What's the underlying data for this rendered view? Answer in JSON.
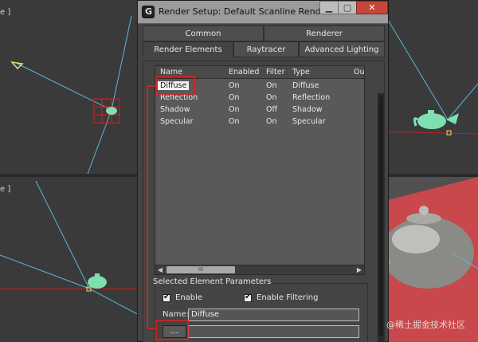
{
  "viewports": {
    "top_left_label": "e ]",
    "bottom_left_label": "e ]"
  },
  "dialog": {
    "title": "Render Setup: Default Scanline Renderer",
    "window_buttons": {
      "minimize": "▁",
      "restore": "▢",
      "close": "✕"
    },
    "tabs_row1": [
      "Common",
      "Renderer"
    ],
    "tabs_row2": [
      "Render Elements",
      "Raytracer",
      "Advanced Lighting"
    ],
    "active_tab": "Render Elements",
    "list": {
      "columns": [
        "Name",
        "Enabled",
        "Filter",
        "Type",
        "Ou"
      ],
      "rows": [
        {
          "name": "Diffuse",
          "enabled": "On",
          "filter": "On",
          "type": "Diffuse"
        },
        {
          "name": "Reflection",
          "enabled": "On",
          "filter": "On",
          "type": "Reflection"
        },
        {
          "name": "Shadow",
          "enabled": "On",
          "filter": "Off",
          "type": "Shadow"
        },
        {
          "name": "Specular",
          "enabled": "On",
          "filter": "On",
          "type": "Specular"
        }
      ],
      "selected_row": "Diffuse",
      "scroll_left": "◀",
      "scroll_right": "▶",
      "scroll_grip": "III"
    },
    "selected_params": {
      "group_title": "Selected Element Parameters",
      "enable_label": "Enable",
      "enable_checked": true,
      "enable_filtering_label": "Enable Filtering",
      "enable_filtering_checked": true,
      "name_label": "Name:",
      "name_value": "Diffuse",
      "browse_button": "...",
      "path_value": ""
    }
  },
  "watermark": "@稀土掘金技术社区",
  "colors": {
    "annotation": "#e02020",
    "light_rays": "#57b7dc",
    "teapot_green": "#7ee0b0",
    "floor_red": "#c8484c"
  }
}
